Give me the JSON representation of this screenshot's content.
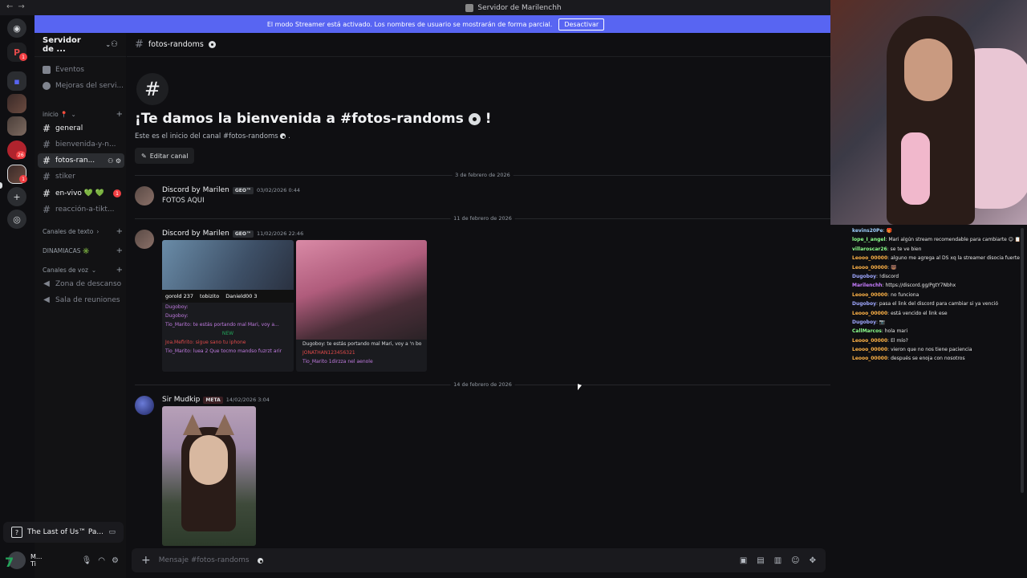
{
  "window": {
    "title": "Servidor de Marilenchh"
  },
  "banner": {
    "text": "El modo Streamer está activado. Los nombres de usuario se mostrarán de forma parcial.",
    "button": "Desactivar"
  },
  "guilds": {
    "badges": [
      "1",
      "26",
      "1"
    ]
  },
  "sidebar": {
    "server_name": "Servidor de ...",
    "top_items": [
      "Eventos",
      "Mejoras del servi..."
    ],
    "category_inicio": "inicio 📍",
    "channels": [
      {
        "label": "general"
      },
      {
        "label": "bienvenida-y-n..."
      },
      {
        "label": "fotos-ran..."
      },
      {
        "label": "stiker"
      },
      {
        "label": "en-vivo 💚 💚",
        "badge": "1"
      },
      {
        "label": "reacción-a-tikt..."
      }
    ],
    "categories": [
      "Canales de texto",
      "DINAMIACAS ✳️",
      "Canales de voz"
    ],
    "voice_channels": [
      "Zona de descanso",
      "Sala de reuniones"
    ],
    "activity": "The Last of Us™ Pa...",
    "user_short": "M... Ti",
    "user_logo": "7"
  },
  "channel": {
    "name": "fotos-randoms",
    "welcome_title": "¡Te damos la bienvenida a #fotos-randoms",
    "welcome_title_end": "!",
    "welcome_sub": "Este es el inicio del canal #fotos-randoms",
    "edit_button": "Editar canal",
    "composer_placeholder": "Mensaje #fotos-randoms"
  },
  "dividers": [
    "3 de febrero de 2026",
    "11 de febrero de 2026",
    "14 de febrero de 2026"
  ],
  "messages": [
    {
      "author": "Discord by Marilen",
      "tag": "GEO™",
      "time": "03/02/2026 0:44",
      "text": "FOTOS AQUI"
    },
    {
      "author": "Discord by Marilen",
      "tag": "GEO™",
      "time": "11/02/2026 22:46"
    },
    {
      "author": "Sir Mudkip",
      "tag": "META",
      "time": "14/02/2026 3:04"
    }
  ],
  "screenshot1": {
    "names": [
      "gorold 237",
      "tobizito",
      "Danield00 3"
    ],
    "lines": [
      "Dugoboy:",
      "Dugoboy:",
      "Tio_Marito: te estás portando mal Mari, voy a...",
      "NEW",
      "Joa.Mefirito: sigue sano tu iphone",
      "Tio_Marito: luea 2 Que tocmo mandso fuzrzt arir"
    ]
  },
  "screenshot2": {
    "lines": [
      "Dugoboy: te estás portando mal Mari, voy a 'n bo",
      "JONATHAN123456321",
      "Tio_Marito 1dirzza nel aenole"
    ]
  },
  "chat": [
    {
      "user": "kevins20Pe",
      "color": "#9fd0ff",
      "text": ": 🎁"
    },
    {
      "user": "lope_I_angel",
      "color": "#8cff8c",
      "text": ": Mari algún stream recomendable para cambiarte 😊 📋"
    },
    {
      "user": "villaroscar26",
      "color": "#8cff8c",
      "text": ": se te ve bien"
    },
    {
      "user": "Leooo_00000",
      "color": "#ffb347",
      "text": ": alguno me agrega al DS xq la streamer disocia fuerte"
    },
    {
      "user": "Leooo_00000",
      "color": "#ffb347",
      "text": ": 🐻"
    },
    {
      "user": "Dugoboy",
      "color": "#9fa8ff",
      "text": ": !discord"
    },
    {
      "user": "Marilenchh",
      "color": "#c77dff",
      "text": ": https://discord.gg/PgtY7Nbhx"
    },
    {
      "user": "Leooo_00000",
      "color": "#ffb347",
      "text": ": no funciona"
    },
    {
      "user": "Dugoboy",
      "color": "#9fa8ff",
      "text": ": pasa el link del discord para cambiar si ya venció"
    },
    {
      "user": "Leooo_00000",
      "color": "#ffb347",
      "text": ": está vencido el link ese"
    },
    {
      "user": "Dugoboy",
      "color": "#9fa8ff",
      "text": ": 📷"
    },
    {
      "user": "CallMarcos",
      "color": "#8cff8c",
      "text": ": hola mari"
    },
    {
      "user": "Leooo_00000",
      "color": "#ffb347",
      "text": ": El mío?"
    },
    {
      "user": "Leooo_00000",
      "color": "#ffb347",
      "text": ": vieron que no nos tiene paciencia"
    },
    {
      "user": "Leooo_00000",
      "color": "#ffb347",
      "text": ": después se enoja con nosotros"
    }
  ]
}
